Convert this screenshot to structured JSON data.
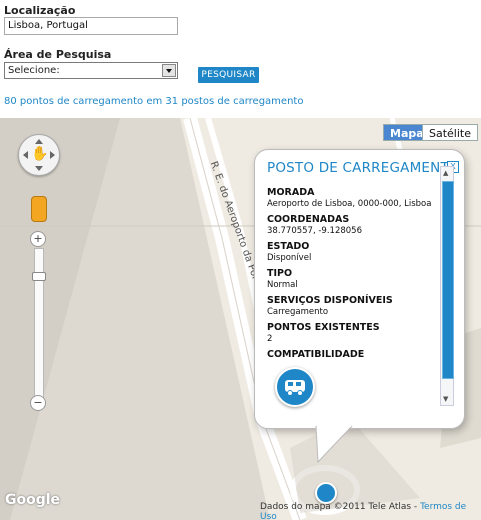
{
  "form": {
    "location_label": "Localização",
    "location_value": "Lisboa, Portugal",
    "area_label": "Área de Pesquisa",
    "area_selected": "Selecione:",
    "search_button": "PESQUISAR",
    "results_text": "80 pontos de carregamento em 31 postos de carregamento"
  },
  "map": {
    "maptype_buttons": [
      "Mapa",
      "Satélite"
    ],
    "road_label": "R. E. do Aeroporto da Portela",
    "zoom_in": "+",
    "zoom_out": "−",
    "logo": "Google",
    "attribution": "Dados do mapa ©2011 Tele Atlas -",
    "terms_link": "Termos de Uso",
    "info": {
      "title": "POSTO DE CARREGAMENTO",
      "fields": [
        {
          "key": "MORADA",
          "value": "Aeroporto de Lisboa, 0000-000, Lisboa"
        },
        {
          "key": "COORDENADAS",
          "value": "38.770557, -9.128056"
        },
        {
          "key": "ESTADO",
          "value": "Disponível"
        },
        {
          "key": "TIPO",
          "value": "Normal"
        },
        {
          "key": "SERVIÇOS DISPONÍVEIS",
          "value": "Carregamento"
        },
        {
          "key": "PONTOS EXISTENTES",
          "value": "2"
        },
        {
          "key": "COMPATIBILIDADE",
          "value": ""
        }
      ],
      "close": "X"
    }
  },
  "colors": {
    "accent": "#1f87c7"
  }
}
